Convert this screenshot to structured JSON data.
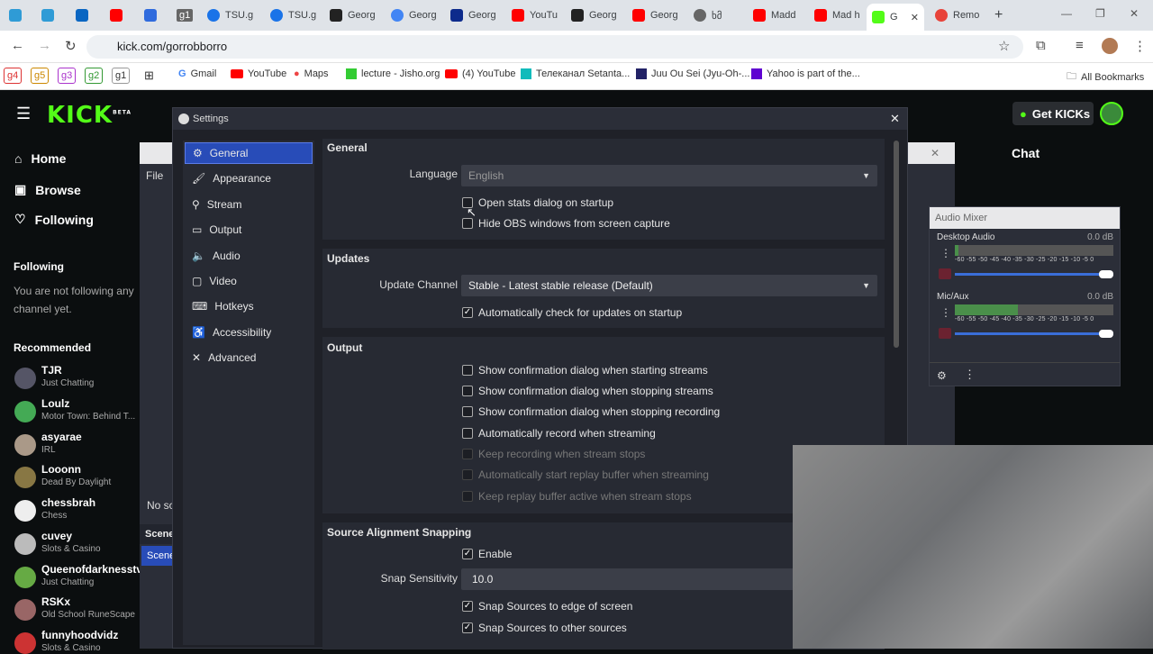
{
  "browser": {
    "tabs": [
      {
        "label": "",
        "color": "#2f9bd6"
      },
      {
        "label": "",
        "color": "#0a66c2"
      },
      {
        "label": "",
        "color": "#ff0000"
      },
      {
        "label": "",
        "color": "#2f6bdd"
      },
      {
        "label": "g1",
        "color": "#555555"
      },
      {
        "label": "TSU.g",
        "color": "#1a73e8"
      },
      {
        "label": "TSU.g",
        "color": "#1a73e8"
      },
      {
        "label": "Georg",
        "color": "#222222"
      },
      {
        "label": "Georg",
        "color": "#4285f4"
      },
      {
        "label": "Georg",
        "color": "#0d2b8c"
      },
      {
        "label": "YouTu",
        "color": "#ff0000"
      },
      {
        "label": "Georg",
        "color": "#222222"
      },
      {
        "label": "Georg",
        "color": "#ff0000"
      },
      {
        "label": "ხმ",
        "color": "#666666"
      },
      {
        "label": "Madd",
        "color": "#ff0000"
      },
      {
        "label": "Mad h",
        "color": "#ff0000"
      },
      {
        "label": "G",
        "color": "#53fc18"
      },
      {
        "label": "Remo",
        "color": "#e8433a"
      }
    ],
    "url": "kick.com/gorrobborro",
    "bookmarks": {
      "folders": [
        "g4",
        "g5",
        "g3",
        "g2",
        "g1"
      ],
      "items": [
        "Gmail",
        "YouTube",
        "Maps",
        "lecture - Jisho.org",
        "(4) YouTube",
        "Телеканал Setanta...",
        "Juu Ou Sei (Jyu-Oh-...",
        "Yahoo is part of the..."
      ],
      "all": "All Bookmarks"
    }
  },
  "kick": {
    "logo": "KICK",
    "beta": "BETA",
    "nav": [
      "Home",
      "Browse",
      "Following"
    ],
    "following_title": "Following",
    "following_empty": "You are not following any channel yet.",
    "recommended_title": "Recommended",
    "recommended": [
      {
        "name": "TJR",
        "cat": "Just Chatting"
      },
      {
        "name": "Loulz",
        "cat": "Motor Town: Behind T..."
      },
      {
        "name": "asyarae",
        "cat": "IRL"
      },
      {
        "name": "Looonn",
        "cat": "Dead By Daylight"
      },
      {
        "name": "chessbrah",
        "cat": "Chess"
      },
      {
        "name": "cuvey",
        "cat": "Slots & Casino"
      },
      {
        "name": "Queenofdarknesstv",
        "cat": "Just Chatting"
      },
      {
        "name": "RSKx",
        "cat": "Old School RuneScape"
      },
      {
        "name": "funnyhoodvidz",
        "cat": "Slots & Casino"
      }
    ],
    "get_kicks": "Get KICKs",
    "chat": "Chat"
  },
  "obs": {
    "file_menu": "File",
    "no_source": "No sc",
    "scenes": "Scene",
    "scene_item": "Scene"
  },
  "settings": {
    "title": "Settings",
    "sidebar": [
      "General",
      "Appearance",
      "Stream",
      "Output",
      "Audio",
      "Video",
      "Hotkeys",
      "Accessibility",
      "Advanced"
    ],
    "general": {
      "header": "General",
      "language_label": "Language",
      "language_value": "English",
      "open_stats": "Open stats dialog on startup",
      "hide_obs": "Hide OBS windows from screen capture"
    },
    "updates": {
      "header": "Updates",
      "channel_label": "Update Channel",
      "channel_value": "Stable - Latest stable release (Default)",
      "auto_check": "Automatically check for updates on startup"
    },
    "output": {
      "header": "Output",
      "items": [
        "Show confirmation dialog when starting streams",
        "Show confirmation dialog when stopping streams",
        "Show confirmation dialog when stopping recording",
        "Automatically record when streaming",
        "Keep recording when stream stops",
        "Automatically start replay buffer when streaming",
        "Keep replay buffer active when stream stops"
      ]
    },
    "snapping": {
      "header": "Source Alignment Snapping",
      "enable": "Enable",
      "sensitivity_label": "Snap Sensitivity",
      "sensitivity_value": "10.0",
      "edge": "Snap Sources to edge of screen",
      "other": "Snap Sources to other sources"
    }
  },
  "mixer": {
    "title": "Audio Mixer",
    "channels": [
      {
        "name": "Desktop Audio",
        "db": "0.0 dB"
      },
      {
        "name": "Mic/Aux",
        "db": "0.0 dB"
      }
    ],
    "scale": "-60 -55 -50 -45 -40 -35 -30 -25 -20 -15 -10  -5   0"
  }
}
